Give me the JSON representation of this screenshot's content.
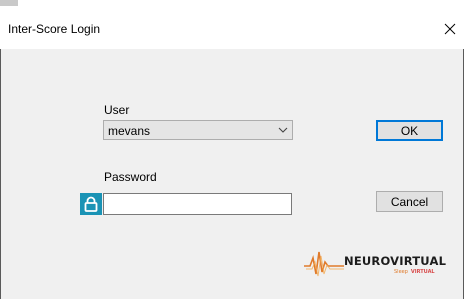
{
  "window": {
    "title": "Inter-Score Login",
    "close_icon": "close-icon"
  },
  "form": {
    "user_label": "User",
    "user_value": "mevans",
    "password_label": "Password",
    "password_value": "",
    "lock_icon": "lock-icon",
    "dropdown_icon": "chevron-down-icon"
  },
  "buttons": {
    "ok_label": "OK",
    "cancel_label": "Cancel"
  },
  "logo": {
    "name": "NEUROVIRTUAL",
    "tagline_1": "Sleep",
    "tagline_2": "VIRTUAL"
  },
  "colors": {
    "lock_bg": "#1a93b5",
    "default_button_border": "#0078d7",
    "logo_orange": "#e07a2a"
  }
}
